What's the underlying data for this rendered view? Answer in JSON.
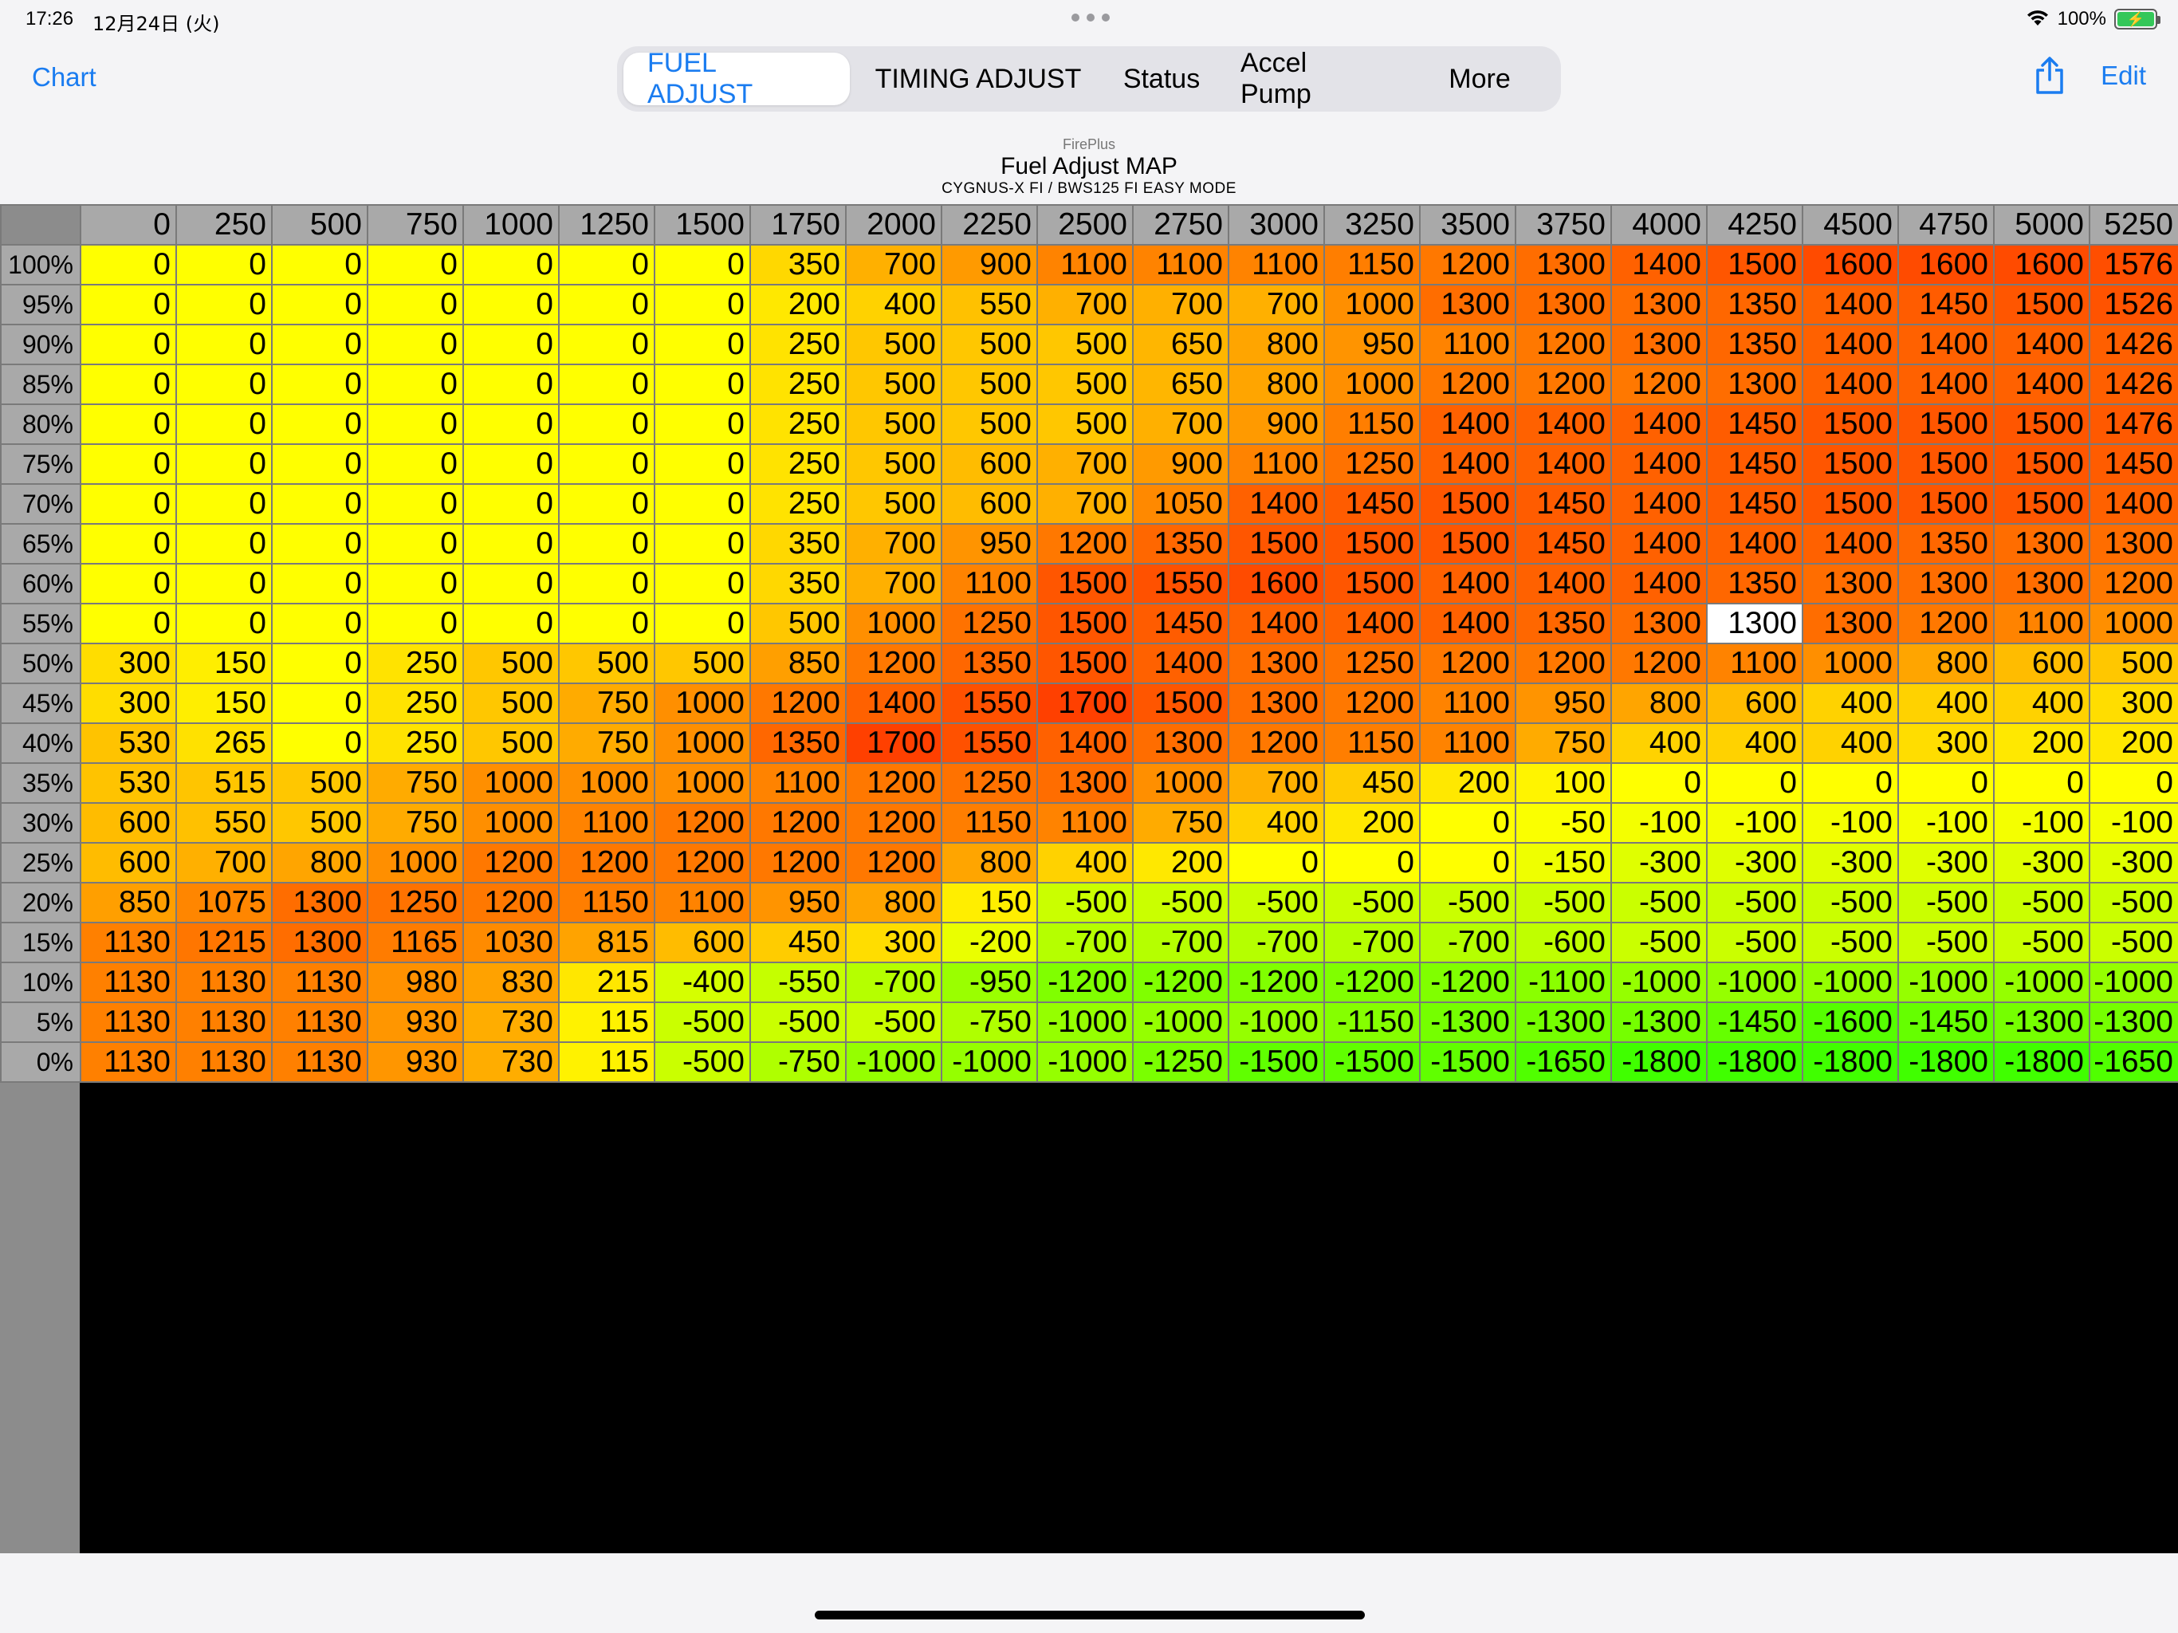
{
  "status_bar": {
    "time": "17:26",
    "date": "12月24日 (火)",
    "battery": "100%"
  },
  "nav": {
    "left_label": "Chart",
    "segments": [
      "FUEL ADJUST",
      "TIMING ADJUST",
      "Status",
      "Accel Pump",
      "More"
    ],
    "active_segment": "FUEL ADJUST",
    "edit_label": "Edit"
  },
  "header": {
    "app_name": "FirePlus",
    "title": "Fuel Adjust MAP",
    "subtitle": "CYGNUS-X FI / BWS125 FI EASY MODE"
  },
  "table": {
    "columns": [
      "0",
      "250",
      "500",
      "750",
      "1000",
      "1250",
      "1500",
      "1750",
      "2000",
      "2250",
      "2500",
      "2750",
      "3000",
      "3250",
      "3500",
      "3750",
      "4000",
      "4250",
      "4500",
      "4750",
      "5000",
      "5250"
    ],
    "selected_cell": {
      "row": 9,
      "col": 17
    },
    "rows": [
      {
        "label": "100%",
        "values": [
          0,
          0,
          0,
          0,
          0,
          0,
          0,
          350,
          700,
          900,
          1100,
          1100,
          1100,
          1150,
          1200,
          1300,
          1400,
          1500,
          1600,
          1600,
          1600,
          1576
        ]
      },
      {
        "label": "95%",
        "values": [
          0,
          0,
          0,
          0,
          0,
          0,
          0,
          200,
          400,
          550,
          700,
          700,
          700,
          1000,
          1300,
          1300,
          1300,
          1350,
          1400,
          1450,
          1500,
          1526
        ]
      },
      {
        "label": "90%",
        "values": [
          0,
          0,
          0,
          0,
          0,
          0,
          0,
          250,
          500,
          500,
          500,
          650,
          800,
          950,
          1100,
          1200,
          1300,
          1350,
          1400,
          1400,
          1400,
          1426
        ]
      },
      {
        "label": "85%",
        "values": [
          0,
          0,
          0,
          0,
          0,
          0,
          0,
          250,
          500,
          500,
          500,
          650,
          800,
          1000,
          1200,
          1200,
          1200,
          1300,
          1400,
          1400,
          1400,
          1426
        ]
      },
      {
        "label": "80%",
        "values": [
          0,
          0,
          0,
          0,
          0,
          0,
          0,
          250,
          500,
          500,
          500,
          700,
          900,
          1150,
          1400,
          1400,
          1400,
          1450,
          1500,
          1500,
          1500,
          1476
        ]
      },
      {
        "label": "75%",
        "values": [
          0,
          0,
          0,
          0,
          0,
          0,
          0,
          250,
          500,
          600,
          700,
          900,
          1100,
          1250,
          1400,
          1400,
          1400,
          1450,
          1500,
          1500,
          1500,
          1450
        ]
      },
      {
        "label": "70%",
        "values": [
          0,
          0,
          0,
          0,
          0,
          0,
          0,
          250,
          500,
          600,
          700,
          1050,
          1400,
          1450,
          1500,
          1450,
          1400,
          1450,
          1500,
          1500,
          1500,
          1400
        ]
      },
      {
        "label": "65%",
        "values": [
          0,
          0,
          0,
          0,
          0,
          0,
          0,
          350,
          700,
          950,
          1200,
          1350,
          1500,
          1500,
          1500,
          1450,
          1400,
          1400,
          1400,
          1350,
          1300,
          1300
        ]
      },
      {
        "label": "60%",
        "values": [
          0,
          0,
          0,
          0,
          0,
          0,
          0,
          350,
          700,
          1100,
          1500,
          1550,
          1600,
          1500,
          1400,
          1400,
          1400,
          1350,
          1300,
          1300,
          1300,
          1200
        ]
      },
      {
        "label": "55%",
        "values": [
          0,
          0,
          0,
          0,
          0,
          0,
          0,
          500,
          1000,
          1250,
          1500,
          1450,
          1400,
          1400,
          1400,
          1350,
          1300,
          1300,
          1300,
          1200,
          1100,
          1000
        ]
      },
      {
        "label": "50%",
        "values": [
          300,
          150,
          0,
          250,
          500,
          500,
          500,
          850,
          1200,
          1350,
          1500,
          1400,
          1300,
          1250,
          1200,
          1200,
          1200,
          1100,
          1000,
          800,
          600,
          500
        ]
      },
      {
        "label": "45%",
        "values": [
          300,
          150,
          0,
          250,
          500,
          750,
          1000,
          1200,
          1400,
          1550,
          1700,
          1500,
          1300,
          1200,
          1100,
          950,
          800,
          600,
          400,
          400,
          400,
          300
        ]
      },
      {
        "label": "40%",
        "values": [
          530,
          265,
          0,
          250,
          500,
          750,
          1000,
          1350,
          1700,
          1550,
          1400,
          1300,
          1200,
          1150,
          1100,
          750,
          400,
          400,
          400,
          300,
          200,
          200
        ]
      },
      {
        "label": "35%",
        "values": [
          530,
          515,
          500,
          750,
          1000,
          1000,
          1000,
          1100,
          1200,
          1250,
          1300,
          1000,
          700,
          450,
          200,
          100,
          0,
          0,
          0,
          0,
          0,
          0
        ]
      },
      {
        "label": "30%",
        "values": [
          600,
          550,
          500,
          750,
          1000,
          1100,
          1200,
          1200,
          1200,
          1150,
          1100,
          750,
          400,
          200,
          0,
          -50,
          -100,
          -100,
          -100,
          -100,
          -100,
          -100
        ]
      },
      {
        "label": "25%",
        "values": [
          600,
          700,
          800,
          1000,
          1200,
          1200,
          1200,
          1200,
          1200,
          800,
          400,
          200,
          0,
          0,
          0,
          -150,
          -300,
          -300,
          -300,
          -300,
          -300,
          -300
        ]
      },
      {
        "label": "20%",
        "values": [
          850,
          1075,
          1300,
          1250,
          1200,
          1150,
          1100,
          950,
          800,
          150,
          -500,
          -500,
          -500,
          -500,
          -500,
          -500,
          -500,
          -500,
          -500,
          -500,
          -500,
          -500
        ]
      },
      {
        "label": "15%",
        "values": [
          1130,
          1215,
          1300,
          1165,
          1030,
          815,
          600,
          450,
          300,
          -200,
          -700,
          -700,
          -700,
          -700,
          -700,
          -600,
          -500,
          -500,
          -500,
          -500,
          -500,
          -500
        ]
      },
      {
        "label": "10%",
        "values": [
          1130,
          1130,
          1130,
          980,
          830,
          215,
          -400,
          -550,
          -700,
          -950,
          -1200,
          -1200,
          -1200,
          -1200,
          -1200,
          -1100,
          -1000,
          -1000,
          -1000,
          -1000,
          -1000,
          -1000
        ]
      },
      {
        "label": "5%",
        "values": [
          1130,
          1130,
          1130,
          930,
          730,
          115,
          -500,
          -500,
          -500,
          -750,
          -1000,
          -1000,
          -1000,
          -1150,
          -1300,
          -1300,
          -1300,
          -1450,
          -1600,
          -1450,
          -1300,
          -1300
        ]
      },
      {
        "label": "0%",
        "values": [
          1130,
          1130,
          1130,
          930,
          730,
          115,
          -500,
          -750,
          -1000,
          -1000,
          -1000,
          -1250,
          -1500,
          -1500,
          -1500,
          -1650,
          -1800,
          -1800,
          -1800,
          -1800,
          -1800,
          -1650
        ]
      }
    ]
  },
  "colors": {
    "accent": "#1a7cf0",
    "selected_cell": "#ffffff"
  }
}
